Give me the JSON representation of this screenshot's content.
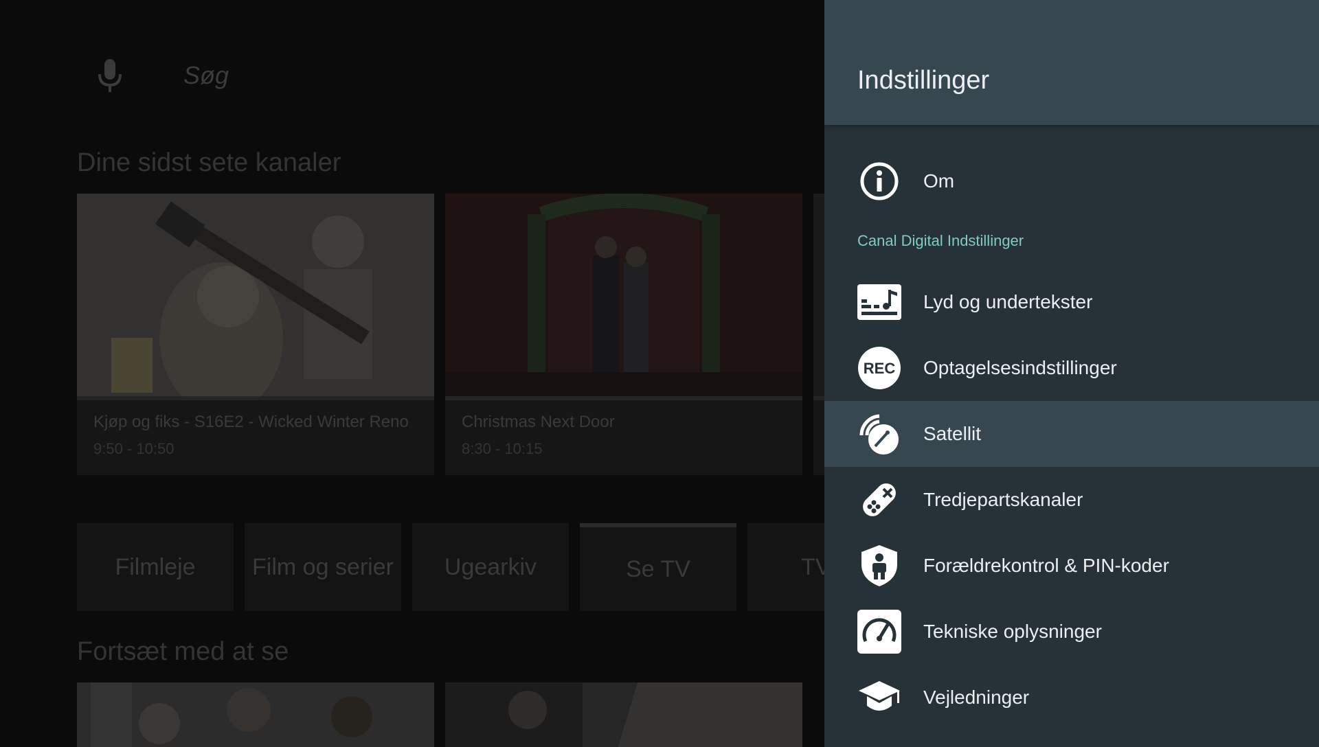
{
  "home": {
    "search_placeholder": "Søg",
    "recent_channels_title": "Dine sidst sete kanaler",
    "recent_channels": [
      {
        "title": "Kjøp og fiks - S16E2 - Wicked Winter Reno",
        "time": "9:50 - 10:50"
      },
      {
        "title": "Christmas Next Door",
        "time": "8:30 - 10:15"
      }
    ],
    "tiles": [
      "Filmleje",
      "Film og serier",
      "Ugearkiv",
      "Se TV",
      "TV g"
    ],
    "continue_title": "Fortsæt med at se"
  },
  "settings": {
    "title": "Indstillinger",
    "items_top": [
      {
        "label": "Om",
        "icon": "info-icon"
      }
    ],
    "category": "Canal Digital Indstillinger",
    "items": [
      {
        "label": "Lyd og undertekster",
        "icon": "audio-subtitles-icon"
      },
      {
        "label": "Optagelsesindstillinger",
        "icon": "rec-icon"
      },
      {
        "label": "Satellit",
        "icon": "satellite-dish-icon",
        "selected": true
      },
      {
        "label": "Tredjepartskanaler",
        "icon": "gamepad-icon"
      },
      {
        "label": "Forældrekontrol & PIN-koder",
        "icon": "parental-shield-icon"
      },
      {
        "label": "Tekniske oplysninger",
        "icon": "gauge-icon"
      },
      {
        "label": "Vejledninger",
        "icon": "graduation-cap-icon"
      }
    ]
  },
  "colors": {
    "panel_bg": "#263238",
    "panel_header": "#37474f",
    "selected_row": "#37474f",
    "category_accent": "#80cbc4"
  }
}
